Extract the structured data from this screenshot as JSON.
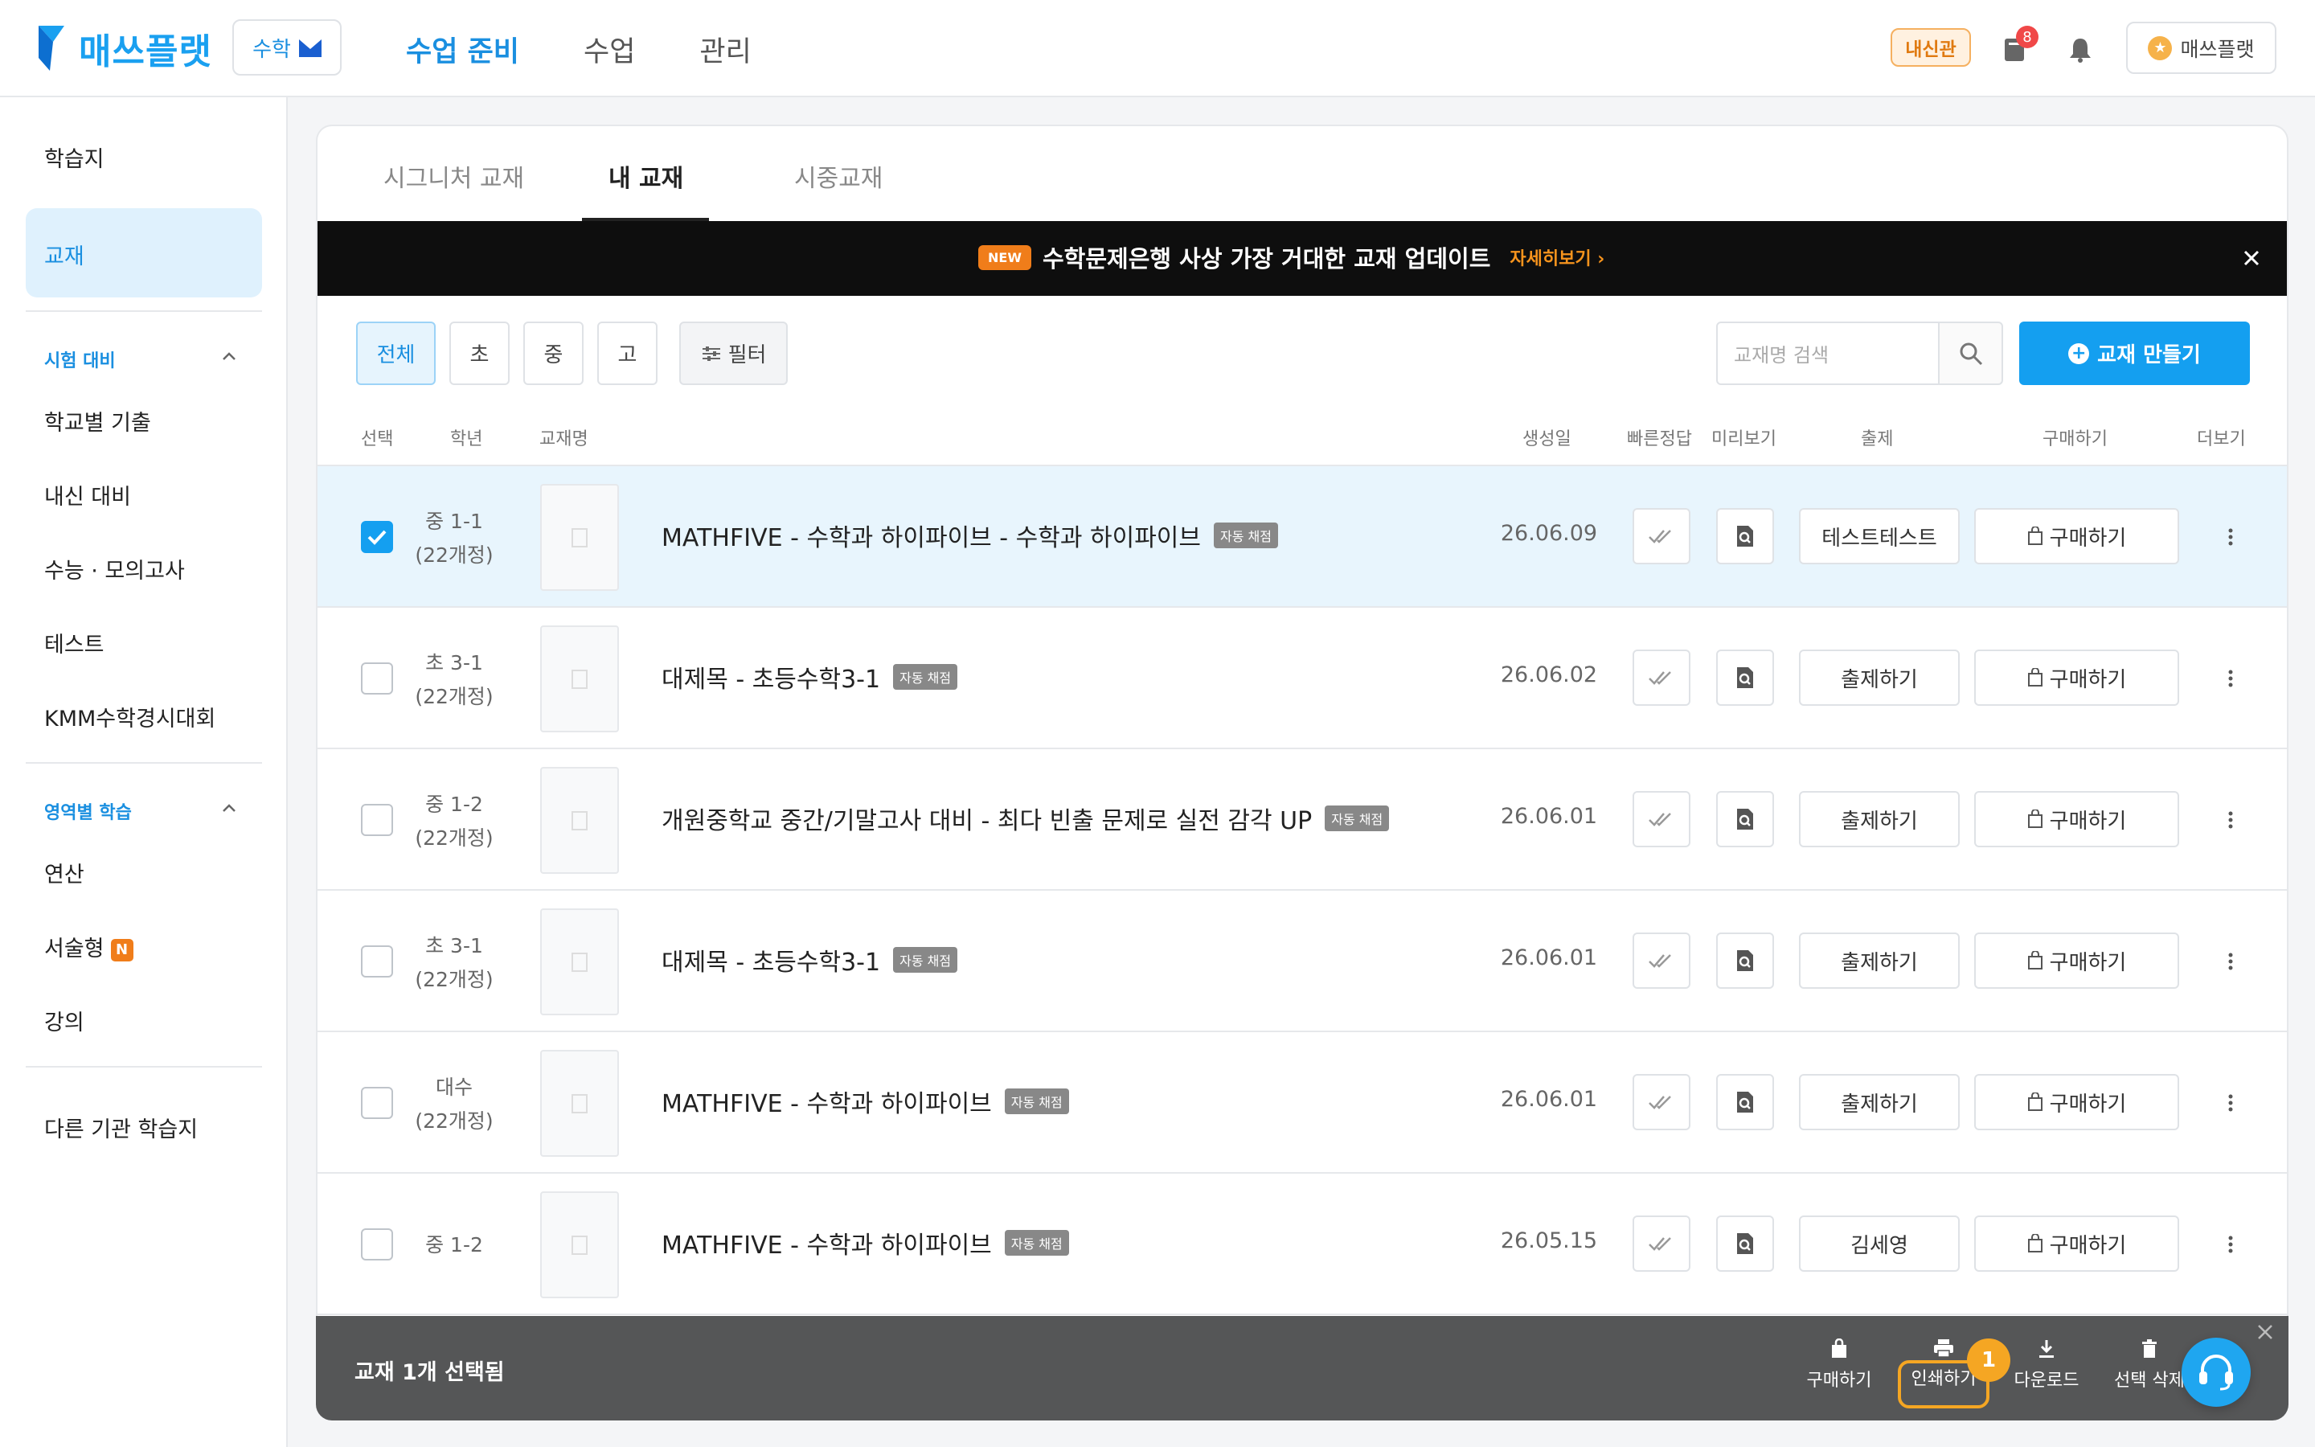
{
  "header": {
    "logo_text": "매쓰플랫",
    "subject": "수학",
    "nav": [
      "수업 준비",
      "수업",
      "관리"
    ],
    "naesin_badge": "내신관",
    "notification_count": "8",
    "user_label": "매쓰플랫"
  },
  "sidebar": {
    "item_worksheet": "학습지",
    "item_textbook": "교재",
    "section_exam": "시험 대비",
    "exam_items": [
      "학교별 기출",
      "내신 대비",
      "수능 · 모의고사",
      "테스트",
      "KMM수학경시대회"
    ],
    "section_area": "영역별 학습",
    "area_items": [
      "연산",
      "서술형",
      "강의"
    ],
    "new_badge": "N",
    "item_other": "다른 기관 학습지"
  },
  "tabs": [
    "시그니처 교재",
    "내 교재",
    "시중교재"
  ],
  "banner": {
    "new_label": "NEW",
    "text": "수학문제은행 사상 가장 거대한 교재 업데이트",
    "link": "자세히보기"
  },
  "filters": [
    "전체",
    "초",
    "중",
    "고"
  ],
  "filter_button": "필터",
  "search": {
    "placeholder": "교재명 검색"
  },
  "create_button": "교재 만들기",
  "columns": {
    "select": "선택",
    "grade": "학년",
    "name": "교재명",
    "created": "생성일",
    "quick_answer": "빠른정답",
    "preview": "미리보기",
    "assign": "출제",
    "buy": "구매하기",
    "more": "더보기"
  },
  "auto_badge": "자동 채점",
  "buy_label": "구매하기",
  "rows": [
    {
      "grade1": "중 1-1",
      "grade2": "(22개정)",
      "title": "MATHFIVE - 수학과 하이파이브 - 수학과 하이파이브",
      "date": "26.06.09",
      "action": "테스트테스트",
      "checked": true
    },
    {
      "grade1": "초 3-1",
      "grade2": "(22개정)",
      "title": "대제목 - 초등수학3-1",
      "date": "26.06.02",
      "action": "출제하기",
      "checked": false
    },
    {
      "grade1": "중 1-2",
      "grade2": "(22개정)",
      "title": "개원중학교 중간/기말고사 대비 - 최다 빈출 문제로 실전 감각 UP",
      "date": "26.06.01",
      "action": "출제하기",
      "checked": false
    },
    {
      "grade1": "초 3-1",
      "grade2": "(22개정)",
      "title": "대제목 - 초등수학3-1",
      "date": "26.06.01",
      "action": "출제하기",
      "checked": false
    },
    {
      "grade1": "대수",
      "grade2": "(22개정)",
      "title": "MATHFIVE - 수학과 하이파이브",
      "date": "26.06.01",
      "action": "출제하기",
      "checked": false
    },
    {
      "grade1": "중 1-2",
      "grade2": "",
      "title": "MATHFIVE - 수학과 하이파이브",
      "date": "26.05.15",
      "action": "김세영",
      "checked": false
    }
  ],
  "bottom_bar": {
    "selected_text": "교재 1개 선택됨",
    "actions": [
      "구매하기",
      "인쇄하기",
      "다운로드",
      "선택 삭제"
    ],
    "print_step": "1"
  },
  "colors": {
    "primary": "#149ff0",
    "accent_orange": "#f5a623",
    "selected_row": "#e8f5fd",
    "banner_bg": "#0e0e0e"
  },
  "icons": [
    "logo-mark-icon",
    "subject-m-icon",
    "book-icon",
    "bell-icon",
    "star-icon",
    "close-icon",
    "filter-sliders-icon",
    "search-icon",
    "plus-circle-icon",
    "check-icon",
    "double-check-icon",
    "preview-icon",
    "bag-icon",
    "kebab-icon",
    "print-icon",
    "download-icon",
    "trash-icon",
    "headset-icon",
    "chevron-up-icon",
    "chevron-right-icon"
  ]
}
